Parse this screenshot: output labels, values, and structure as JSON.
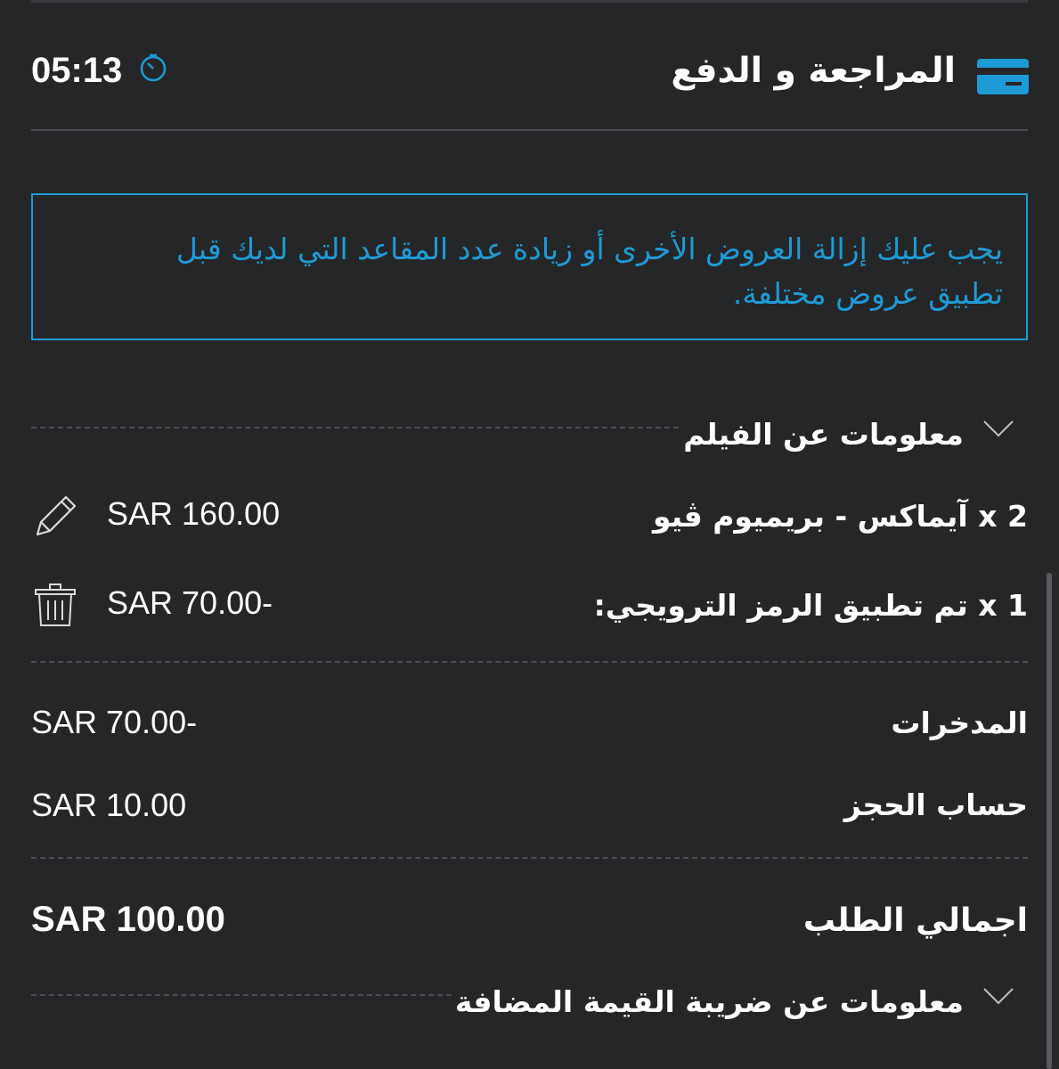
{
  "header": {
    "title": "المراجعة و الدفع",
    "timer": "05:13",
    "card_icon": "credit-card-icon",
    "timer_icon": "stopwatch-icon"
  },
  "notice": {
    "text": "يجب عليك إزالة العروض الأخرى أو زيادة عدد المقاعد التي لديك قبل تطبيق عروض مختلفة."
  },
  "film_info": {
    "label": "معلومات عن الفيلم"
  },
  "items": [
    {
      "label": "2 x آيماكس - بريميوم ڤيو",
      "price": "SAR 160.00",
      "action_icon": "pencil-icon"
    },
    {
      "label": "1 x تم تطبيق الرمز الترويجي:",
      "price": "SAR 70.00-",
      "action_icon": "trash-icon"
    }
  ],
  "summary": {
    "savings_label": "المدخرات",
    "savings_value": "SAR 70.00-",
    "booking_label": "حساب الحجز",
    "booking_value": "SAR 10.00",
    "total_label": "اجمالي الطلب",
    "total_value": "SAR 100.00"
  },
  "vat_info": {
    "label": "معلومات عن ضريبة القيمة المضافة"
  },
  "colors": {
    "background": "#252628",
    "accent": "#1e9bd7",
    "text": "#ffffff"
  }
}
